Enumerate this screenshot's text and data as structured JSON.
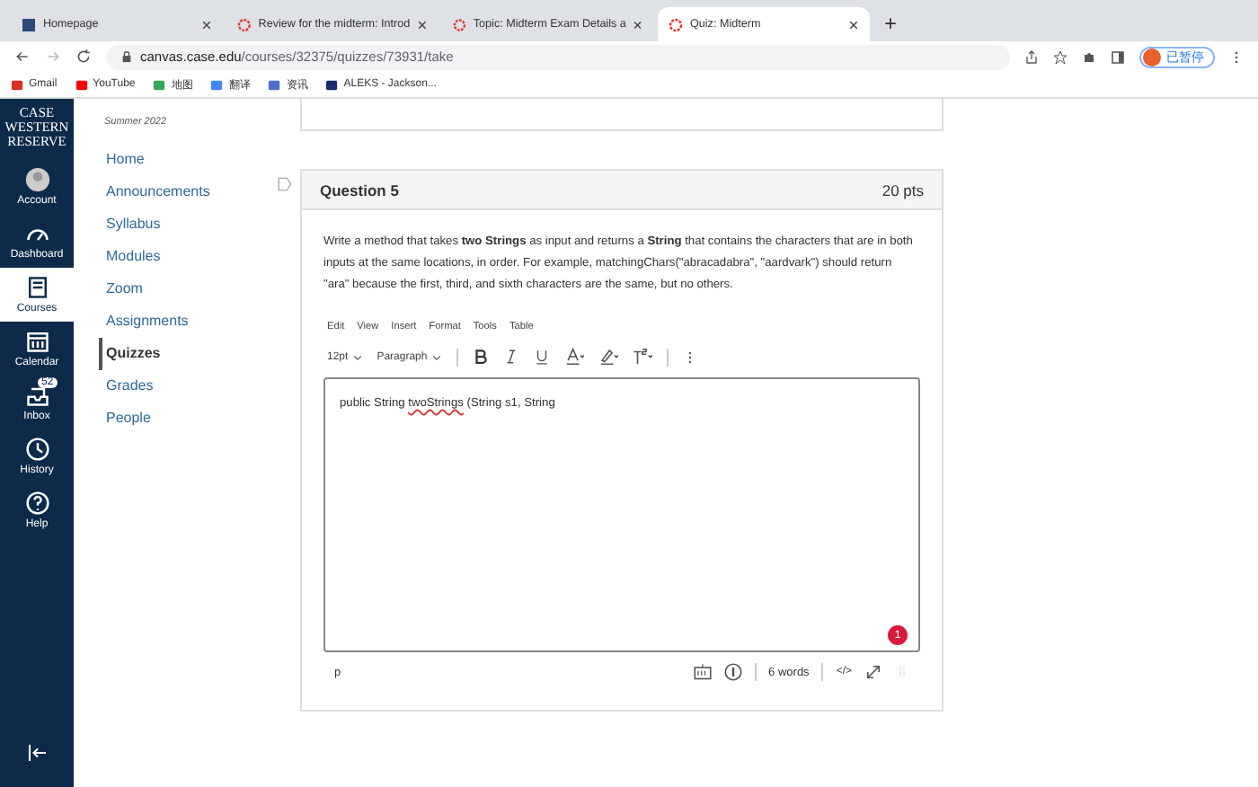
{
  "browser": {
    "tabs": [
      {
        "title": "Homepage",
        "selected": false,
        "kind": "square"
      },
      {
        "title": "Review for the midterm: Introd",
        "selected": false,
        "kind": "canvas"
      },
      {
        "title": "Topic: Midterm Exam Details a",
        "selected": false,
        "kind": "canvas"
      },
      {
        "title": "Quiz: Midterm",
        "selected": true,
        "kind": "canvas"
      }
    ],
    "new_tab": "+",
    "url_host": "canvas.case.edu",
    "url_path": "/courses/32375/quizzes/73931/take",
    "profile": "已暂停",
    "bookmarks": [
      {
        "label": "Gmail",
        "color": "#d93025"
      },
      {
        "label": "YouTube",
        "color": "#ff0000"
      },
      {
        "label": "地图",
        "color": "#34a853"
      },
      {
        "label": "翻译",
        "color": "#4285f4"
      },
      {
        "label": "资讯",
        "color": "#4a6fd1"
      },
      {
        "label": "ALEKS - Jackson...",
        "color": "#1a2a6c"
      }
    ]
  },
  "logo": [
    "CASE",
    "WESTERN",
    "RESERVE"
  ],
  "global_nav": [
    {
      "label": "Account",
      "kind": "avatar",
      "selected": false
    },
    {
      "label": "Dashboard",
      "kind": "gauge",
      "selected": false
    },
    {
      "label": "Courses",
      "kind": "book",
      "selected": true
    },
    {
      "label": "Calendar",
      "kind": "calendar",
      "selected": false
    },
    {
      "label": "Inbox",
      "kind": "inbox",
      "selected": false,
      "badge": "52"
    },
    {
      "label": "History",
      "kind": "clock",
      "selected": false
    },
    {
      "label": "Help",
      "kind": "help",
      "selected": false
    }
  ],
  "course_nav": {
    "term": "Summer 2022",
    "items": [
      {
        "label": "Home",
        "selected": false
      },
      {
        "label": "Announcements",
        "selected": false
      },
      {
        "label": "Syllabus",
        "selected": false
      },
      {
        "label": "Modules",
        "selected": false
      },
      {
        "label": "Zoom",
        "selected": false
      },
      {
        "label": "Assignments",
        "selected": false
      },
      {
        "label": "Quizzes",
        "selected": true
      },
      {
        "label": "Grades",
        "selected": false
      },
      {
        "label": "People",
        "selected": false
      }
    ]
  },
  "question": {
    "title": "Question 5",
    "points": "20 pts",
    "flagged": false,
    "text": "Write a method that takes **two Strings** as input and returns a **String** that contains the characters that are in both inputs at the same locations, in order. For example, matchingChars(\"abracadabra\", \"aardvark\") should return \"ara\" because the first, third, and sixth characters are the same, but no others.",
    "menu": [
      "Edit",
      "View",
      "Insert",
      "Format",
      "Tools",
      "Table"
    ],
    "font_size": "12pt",
    "block": "Paragraph",
    "answer_before": "public String ",
    "answer_misspelled": "twoStrings",
    "answer_after": " (String s1, String",
    "notice_badge": "1",
    "path": "p",
    "word_count": "6 words",
    "html_toggle": "</>"
  }
}
